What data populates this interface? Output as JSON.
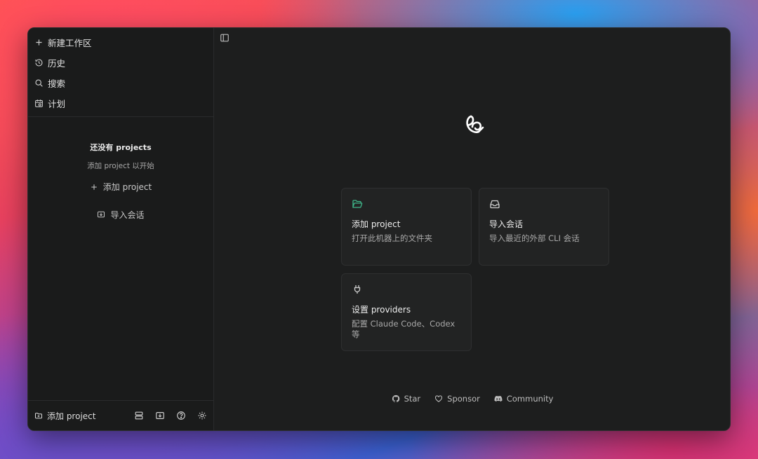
{
  "sidebar": {
    "nav": [
      {
        "label": "新建工作区",
        "icon": "plus-icon"
      },
      {
        "label": "历史",
        "icon": "history-icon"
      },
      {
        "label": "搜索",
        "icon": "search-icon"
      },
      {
        "label": "计划",
        "icon": "calendar-icon"
      }
    ],
    "empty_state": {
      "title": "还没有 projects",
      "subtitle": "添加 project 以开始",
      "add_label": "添加 project",
      "import_label": "导入会话"
    },
    "footer": {
      "add_label": "添加 project",
      "icons": [
        "layout-rows-icon",
        "import-icon",
        "help-icon",
        "settings-icon"
      ]
    }
  },
  "main": {
    "cards": [
      {
        "title": "添加 project",
        "desc": "打开此机器上的文件夹",
        "icon": "folder-open-icon",
        "icon_color": "#3fb78a"
      },
      {
        "title": "导入会话",
        "desc": "导入最近的外部 CLI 会话",
        "icon": "inbox-icon",
        "icon_color": "#d0d0d0"
      },
      {
        "title": "设置 providers",
        "desc": "配置 Claude Code、Codex 等",
        "icon": "plug-icon",
        "icon_color": "#d0d0d0"
      }
    ],
    "links": [
      {
        "label": "Star",
        "icon": "github-icon"
      },
      {
        "label": "Sponsor",
        "icon": "heart-icon"
      },
      {
        "label": "Community",
        "icon": "discord-icon"
      }
    ]
  }
}
